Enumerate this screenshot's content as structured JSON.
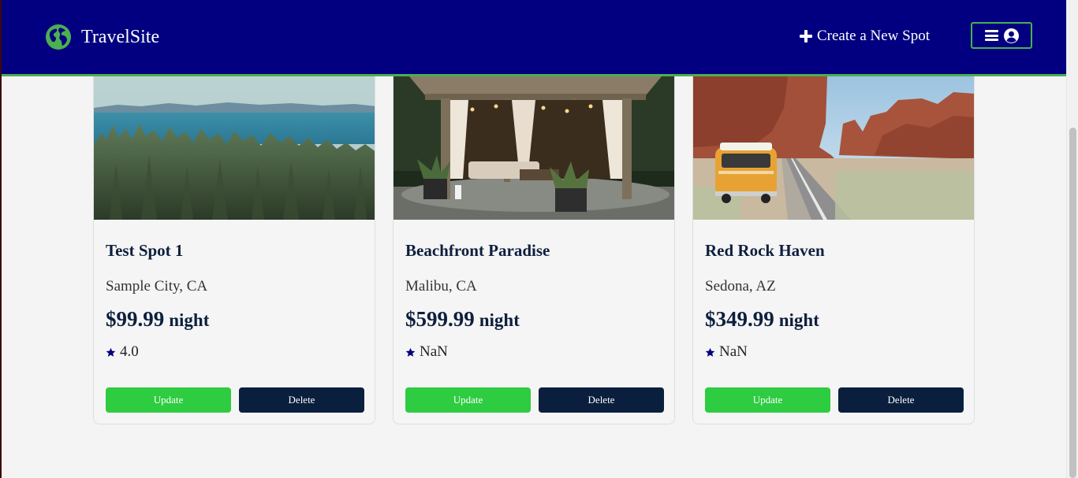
{
  "header": {
    "brand": "TravelSite",
    "create_label": "Create a New Spot",
    "colors": {
      "background": "#020080",
      "accent": "#4caf50"
    },
    "icons": {
      "logo": "globe-icon",
      "create": "plus-icon",
      "menu": "hamburger-icon",
      "user": "user-circle-icon"
    }
  },
  "spots": [
    {
      "title": "Test Spot 1",
      "location": "Sample City, CA",
      "price": "$99.99",
      "unit": "night",
      "rating": "4.0",
      "update_label": "Update",
      "delete_label": "Delete"
    },
    {
      "title": "Beachfront Paradise",
      "location": "Malibu, CA",
      "price": "$599.99",
      "unit": "night",
      "rating": "NaN",
      "update_label": "Update",
      "delete_label": "Delete"
    },
    {
      "title": "Red Rock Haven",
      "location": "Sedona, AZ",
      "price": "$349.99",
      "unit": "night",
      "rating": "NaN",
      "update_label": "Update",
      "delete_label": "Delete"
    }
  ],
  "colors": {
    "update": "#2ecc40",
    "delete": "#0a1f3e",
    "title": "#0e1f3d",
    "star": "#020080"
  }
}
